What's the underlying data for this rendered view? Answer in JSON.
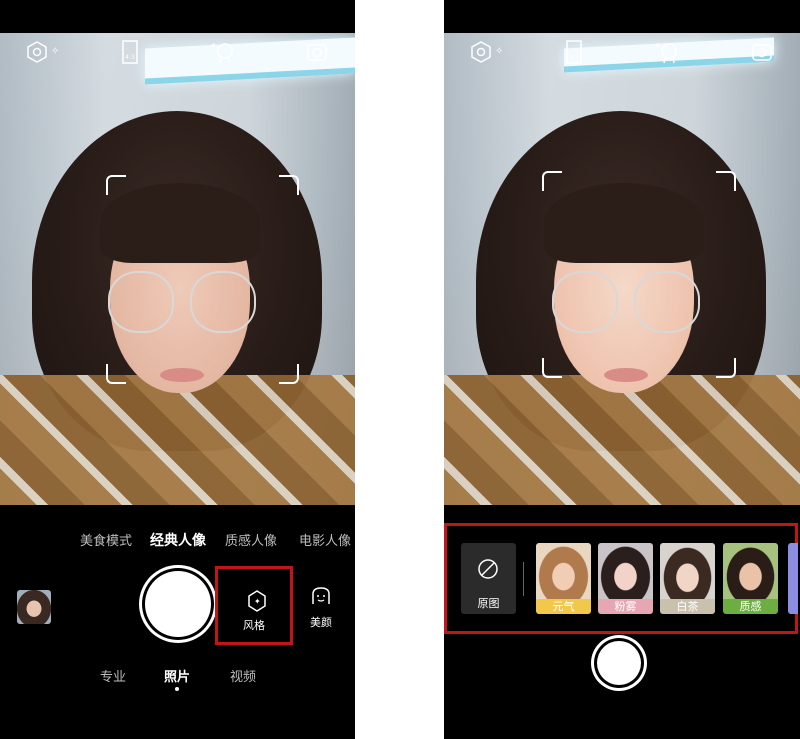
{
  "left_screen": {
    "top_bar": {
      "ratio_label": "4:3"
    },
    "modes": [
      "美食模式",
      "经典人像",
      "质感人像",
      "电影人像"
    ],
    "active_mode": "经典人像",
    "style_button_label": "风格",
    "beauty_button_label": "美颜",
    "bottom_tabs": [
      "专业",
      "照片",
      "视频"
    ],
    "active_bottom_tab": "照片"
  },
  "right_screen": {
    "top_bar": {
      "ratio_label": "4:3"
    },
    "original_label": "原图",
    "filters": [
      {
        "label": "元气",
        "label_color": "#f2c84b"
      },
      {
        "label": "粉雾",
        "label_color": "#e7a6b4"
      },
      {
        "label": "白茶",
        "label_color": "#c9c0ae"
      },
      {
        "label": "质感",
        "label_color": "#6cae3f"
      }
    ]
  },
  "colors": {
    "highlight_border": "#c0151b",
    "background": "#000000"
  }
}
